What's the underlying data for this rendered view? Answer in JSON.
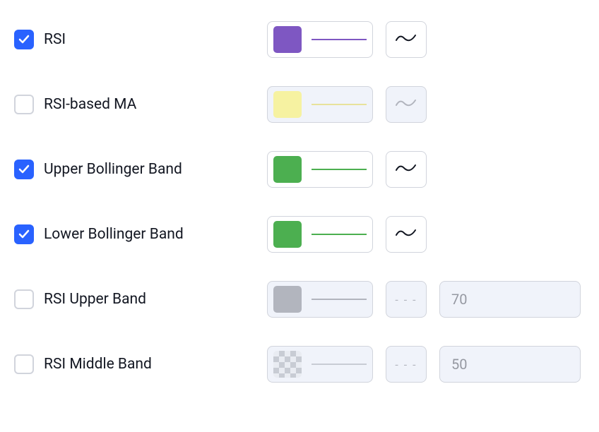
{
  "rows": [
    {
      "id": "rsi",
      "label": "RSI",
      "checked": true,
      "color": "#7e57c2",
      "lineColor": "#7e57c2",
      "colorDisabled": false,
      "styleType": "wave",
      "styleDisabled": false,
      "waveColor": "#131722",
      "hasValue": false
    },
    {
      "id": "rsi-ma",
      "label": "RSI-based MA",
      "checked": false,
      "color": "#f6f2a1",
      "lineColor": "#e8e29b",
      "colorDisabled": true,
      "styleType": "wave",
      "styleDisabled": true,
      "waveColor": "#b2b5be",
      "hasValue": false
    },
    {
      "id": "upper-bb",
      "label": "Upper Bollinger Band",
      "checked": true,
      "color": "#4caf50",
      "lineColor": "#4caf50",
      "colorDisabled": false,
      "styleType": "wave",
      "styleDisabled": false,
      "waveColor": "#131722",
      "hasValue": false
    },
    {
      "id": "lower-bb",
      "label": "Lower Bollinger Band",
      "checked": true,
      "color": "#4caf50",
      "lineColor": "#4caf50",
      "colorDisabled": false,
      "styleType": "wave",
      "styleDisabled": false,
      "waveColor": "#131722",
      "hasValue": false
    },
    {
      "id": "rsi-upper",
      "label": "RSI Upper Band",
      "checked": false,
      "color": "#b2b5be",
      "lineColor": "#b2b5be",
      "colorDisabled": true,
      "styleType": "dash",
      "styleDisabled": true,
      "hasValue": true,
      "value": "70"
    },
    {
      "id": "rsi-middle",
      "label": "RSI Middle Band",
      "checked": false,
      "color": "checker",
      "lineColor": "#c8ccd4",
      "colorDisabled": true,
      "styleType": "dash",
      "styleDisabled": true,
      "hasValue": true,
      "value": "50"
    }
  ]
}
